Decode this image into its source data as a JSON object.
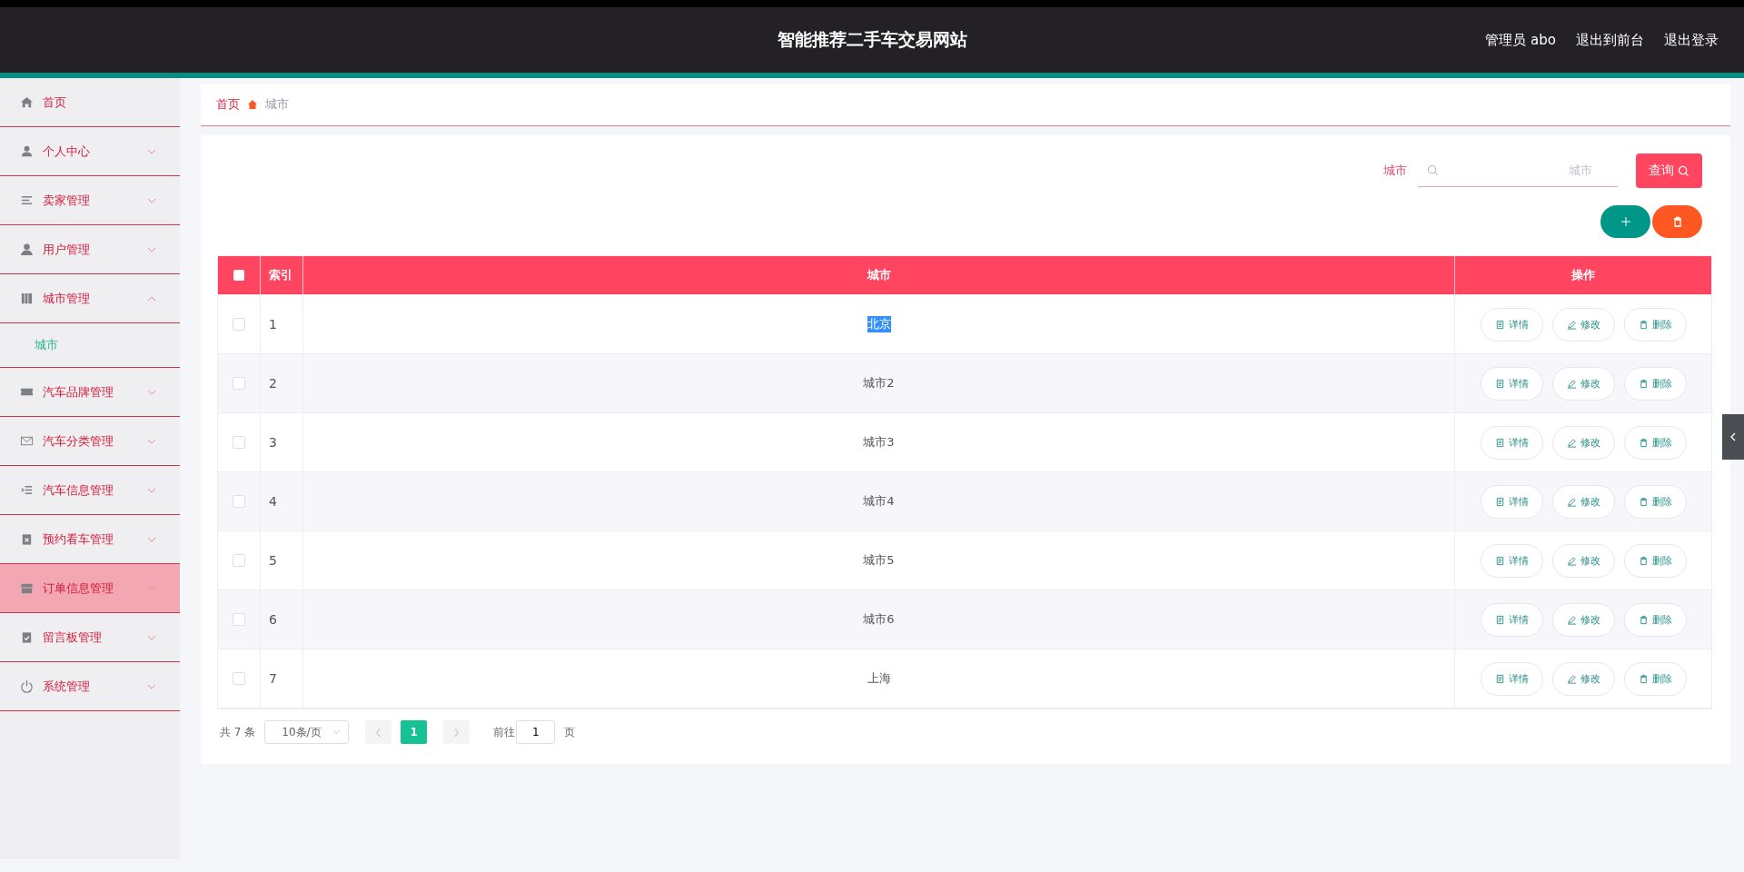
{
  "header": {
    "title": "智能推荐二手车交易网站",
    "links": [
      "管理员 abo",
      "退出到前台",
      "退出登录"
    ]
  },
  "sidebar": {
    "items": [
      {
        "label": "首页",
        "kind": "link",
        "hovered": false
      },
      {
        "label": "个人中心",
        "kind": "group",
        "expanded": false,
        "hovered": false
      },
      {
        "label": "卖家管理",
        "kind": "group",
        "expanded": false,
        "hovered": false
      },
      {
        "label": "用户管理",
        "kind": "group",
        "expanded": false,
        "hovered": false
      },
      {
        "label": "城市管理",
        "kind": "group",
        "expanded": true,
        "hovered": false,
        "children": [
          {
            "label": "城市",
            "selected": true
          }
        ]
      },
      {
        "label": "汽车品牌管理",
        "kind": "group",
        "expanded": false,
        "hovered": false
      },
      {
        "label": "汽车分类管理",
        "kind": "group",
        "expanded": false,
        "hovered": false
      },
      {
        "label": "汽车信息管理",
        "kind": "group",
        "expanded": false,
        "hovered": false
      },
      {
        "label": "预约看车管理",
        "kind": "group",
        "expanded": false,
        "hovered": false
      },
      {
        "label": "订单信息管理",
        "kind": "group",
        "expanded": false,
        "hovered": true
      },
      {
        "label": "留言板管理",
        "kind": "group",
        "expanded": false,
        "hovered": false
      },
      {
        "label": "系统管理",
        "kind": "group",
        "expanded": false,
        "hovered": false
      }
    ]
  },
  "breadcrumb": [
    "首页",
    "城市"
  ],
  "search": {
    "label": "城市",
    "placeholder": "城市",
    "button": "查询"
  },
  "table": {
    "columns": [
      "索引",
      "城市",
      "操作"
    ],
    "all_checked": false,
    "rows": [
      {
        "checked": false,
        "index": "1",
        "city": "北京",
        "highlighted": true,
        "actions": [
          "详情",
          "修改",
          "删除"
        ]
      },
      {
        "checked": false,
        "index": "2",
        "city": "城市2",
        "highlighted": false,
        "actions": [
          "详情",
          "修改",
          "删除"
        ]
      },
      {
        "checked": false,
        "index": "3",
        "city": "城市3",
        "highlighted": false,
        "actions": [
          "详情",
          "修改",
          "删除"
        ]
      },
      {
        "checked": false,
        "index": "4",
        "city": "城市4",
        "highlighted": false,
        "actions": [
          "详情",
          "修改",
          "删除"
        ]
      },
      {
        "checked": false,
        "index": "5",
        "city": "城市5",
        "highlighted": false,
        "actions": [
          "详情",
          "修改",
          "删除"
        ]
      },
      {
        "checked": false,
        "index": "6",
        "city": "城市6",
        "highlighted": false,
        "actions": [
          "详情",
          "修改",
          "删除"
        ]
      },
      {
        "checked": false,
        "index": "7",
        "city": "上海",
        "highlighted": false,
        "actions": [
          "详情",
          "修改",
          "删除"
        ]
      }
    ]
  },
  "pagination": {
    "total": "共 7 条",
    "page_size": "10条/页",
    "pages": [
      {
        "label": "1",
        "selected": true
      }
    ],
    "goto_label": "前往",
    "goto_value": "1",
    "goto_suffix": "页"
  }
}
